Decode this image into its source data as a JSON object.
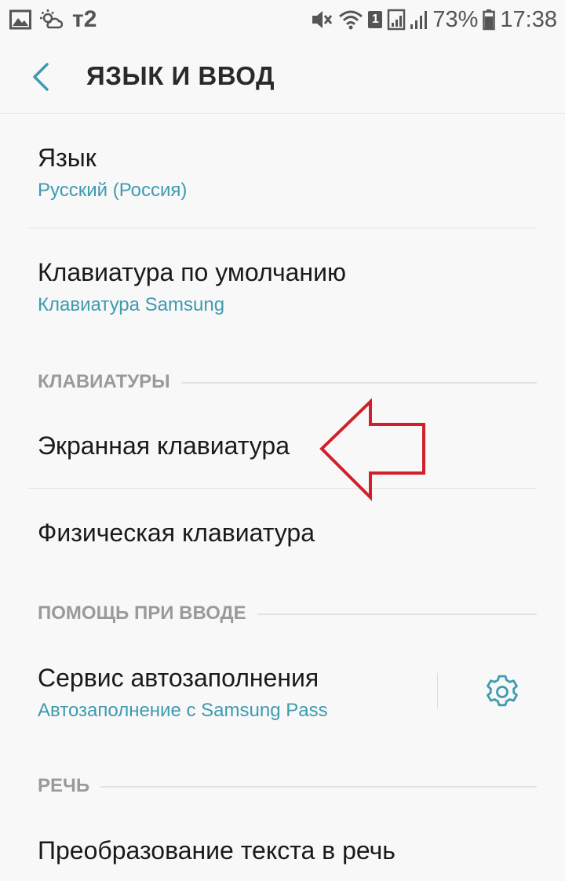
{
  "status_bar": {
    "carrier": "т2",
    "sim_slot": "1",
    "battery": "73%",
    "time": "17:38",
    "icons": [
      "gallery-icon",
      "weather-icon",
      "mute-icon",
      "wifi-icon",
      "signal-icon",
      "battery-icon"
    ]
  },
  "header": {
    "title": "ЯЗЫК И ВВОД",
    "back_icon": "back-arrow-icon"
  },
  "items": {
    "language": {
      "title": "Язык",
      "subtitle": "Русский (Россия)"
    },
    "default_keyboard": {
      "title": "Клавиатура по умолчанию",
      "subtitle": "Клавиатура Samsung"
    },
    "onscreen_keyboard": {
      "title": "Экранная клавиатура"
    },
    "physical_keyboard": {
      "title": "Физическая клавиатура"
    },
    "autofill": {
      "title": "Сервис автозаполнения",
      "subtitle": "Автозаполнение с Samsung Pass",
      "settings_icon": "gear-icon"
    },
    "tts": {
      "title": "Преобразование текста в речь"
    }
  },
  "sections": {
    "keyboards": "КЛАВИАТУРЫ",
    "input_assist": "ПОМОЩЬ ПРИ ВВОДЕ",
    "speech": "РЕЧЬ"
  },
  "colors": {
    "accent": "#3e9bb0",
    "annotation_arrow": "#d0202a",
    "background": "#f8f8f8"
  }
}
